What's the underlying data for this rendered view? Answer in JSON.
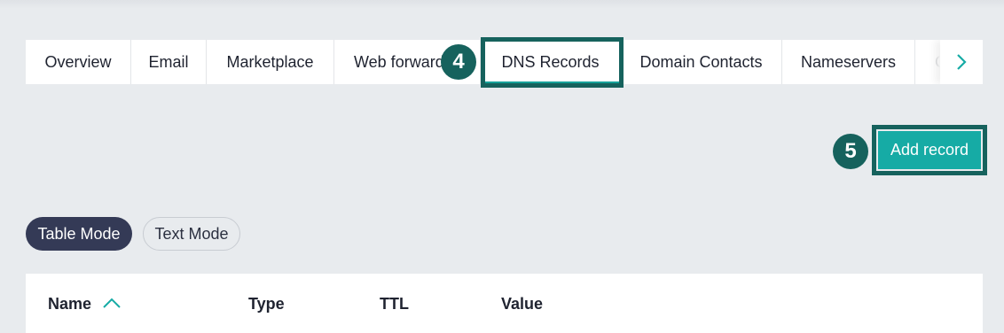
{
  "tabs": [
    {
      "label": "Overview",
      "active": false
    },
    {
      "label": "Email",
      "active": false
    },
    {
      "label": "Marketplace",
      "active": false
    },
    {
      "label": "Web forwarding",
      "active": false
    },
    {
      "label": "DNS Records",
      "active": true
    },
    {
      "label": "Domain Contacts",
      "active": false
    },
    {
      "label": "Nameservers",
      "active": false
    },
    {
      "label": "C",
      "active": false
    }
  ],
  "steps": {
    "tab_step": "4",
    "button_step": "5"
  },
  "actions": {
    "add_record": "Add record"
  },
  "modes": {
    "table": "Table Mode",
    "text": "Text Mode",
    "selected": "Table Mode"
  },
  "table": {
    "columns": [
      "Name",
      "Type",
      "TTL",
      "Value"
    ],
    "sort": {
      "column": "Name",
      "direction": "ascending"
    }
  },
  "colors": {
    "accent": "#16aba5",
    "highlight": "#16625d",
    "active_mode": "#343a56",
    "background": "#e8ebee"
  },
  "icons": {
    "tabs_next": "chevron-right-icon",
    "sort": "chevron-up-icon"
  }
}
